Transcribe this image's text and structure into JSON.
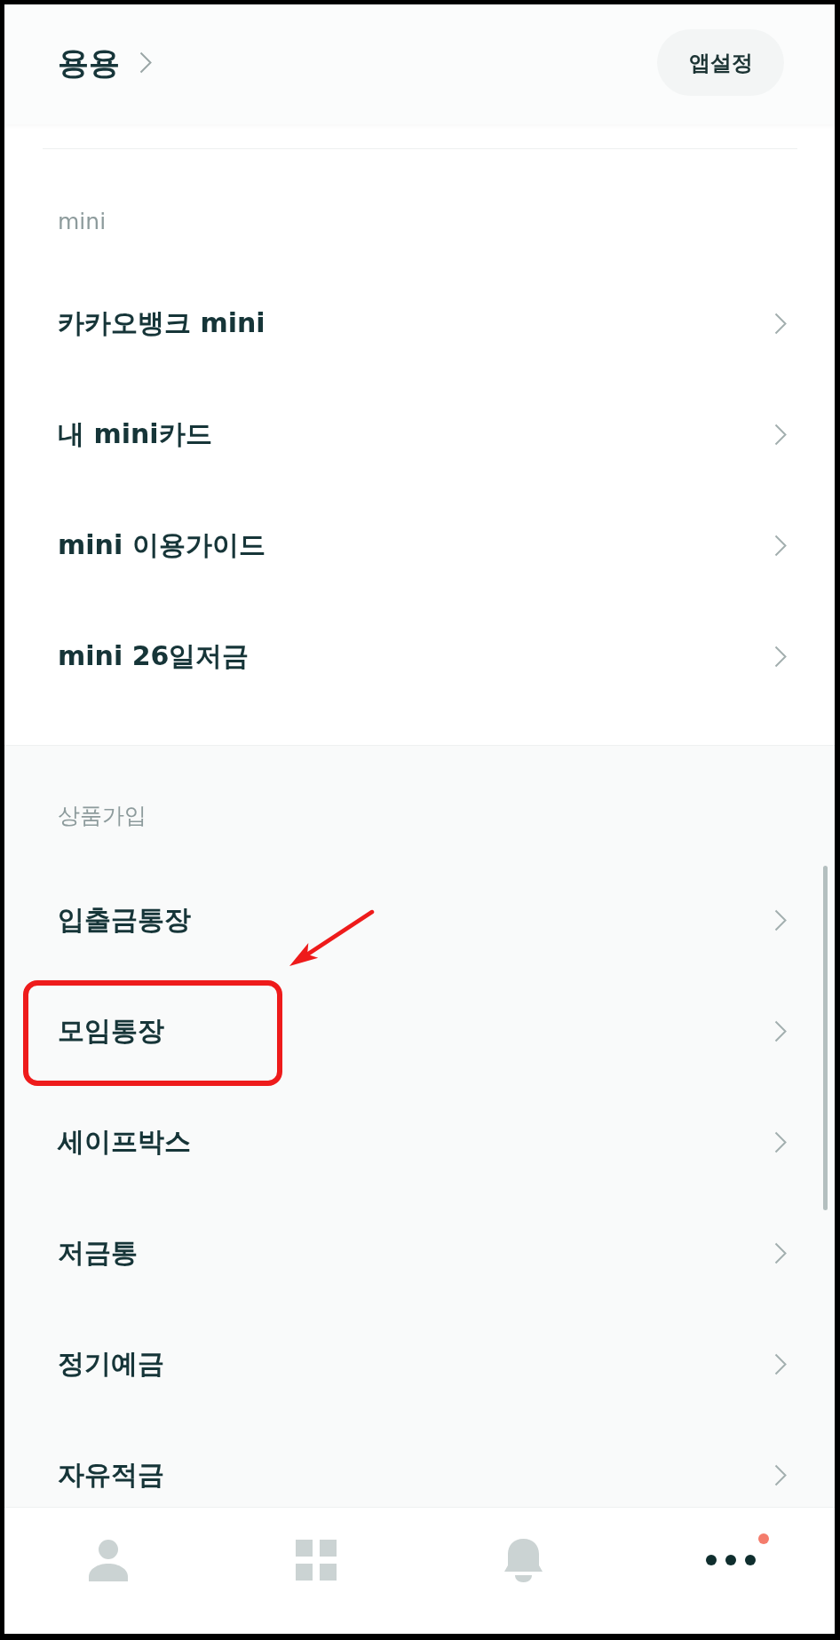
{
  "header": {
    "title": "용용",
    "settings_button": "앱설정"
  },
  "sections": [
    {
      "label": "mini",
      "items": [
        {
          "label": "카카오뱅크 mini",
          "highlighted": false
        },
        {
          "label": "내 mini카드",
          "highlighted": false
        },
        {
          "label": "mini 이용가이드",
          "highlighted": false
        },
        {
          "label": "mini 26일저금",
          "highlighted": false
        }
      ]
    },
    {
      "label": "상품가입",
      "items": [
        {
          "label": "입출금통장",
          "highlighted": false
        },
        {
          "label": "모임통장",
          "highlighted": true
        },
        {
          "label": "세이프박스",
          "highlighted": false
        },
        {
          "label": "저금통",
          "highlighted": false
        },
        {
          "label": "정기예금",
          "highlighted": false
        },
        {
          "label": "자유적금",
          "highlighted": false
        }
      ]
    }
  ],
  "bottom_nav": {
    "tabs": [
      {
        "selected": false,
        "badge": false
      },
      {
        "selected": false,
        "badge": false
      },
      {
        "selected": false,
        "badge": false
      },
      {
        "selected": true,
        "badge": true
      }
    ]
  }
}
